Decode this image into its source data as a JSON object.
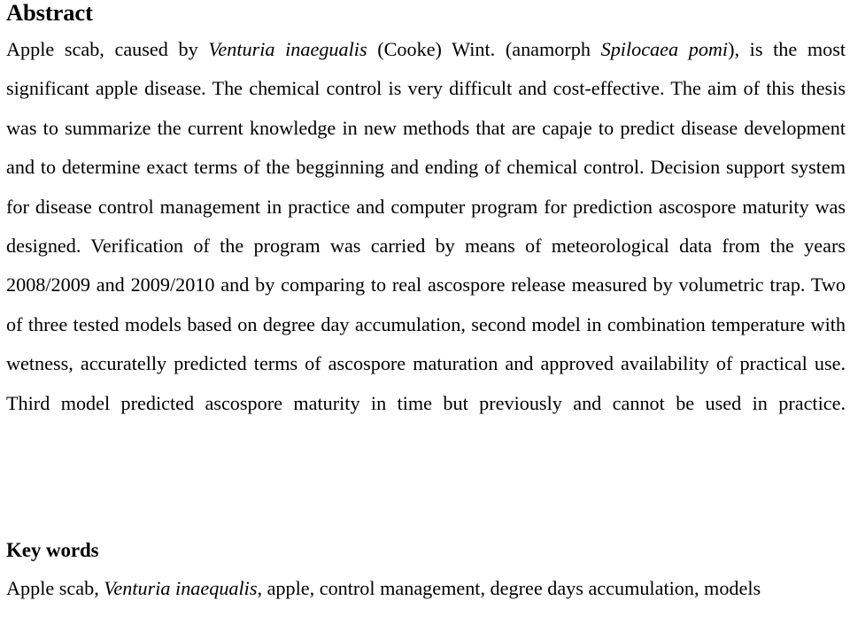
{
  "document": {
    "page_background": "#ffffff",
    "text_color": "#000000"
  },
  "abstract": {
    "heading": "Abstract",
    "paragraph_parts": [
      {
        "text": "Apple scab, caused by ",
        "style": "normal"
      },
      {
        "text": "Venturia inaegualis",
        "style": "italic"
      },
      {
        "text": " (Cooke) Wint. (anamorph ",
        "style": "normal"
      },
      {
        "text": "Spilocaea pomi",
        "style": "italic"
      },
      {
        "text": "), is the most significant apple disease. The chemical control is very difficult and cost-effective. The aim of this thesis was to summarize the current knowledge in new methods that are capaje to predict disease development and to determine exact terms of the begginning and ending of chemical control. Decision support system for disease control management in practice and computer program for prediction ascospore maturity was designed. Verification of the program was carried by means of meteorological data from the years 2008/2009 and 2009/2010 and by comparing to real ascospore release measured by volumetric trap. Two of three tested models based on degree day accumulation, second model in combination temperature with wetness, accuratelly predicted terms of ascospore maturation and approved availability of practical use. Third model predicted ascospore maturity in time but previously and cannot be used in practice.",
        "style": "normal"
      }
    ],
    "paragraph_plain": "Apple scab, caused by Venturia inaegualis (Cooke) Wint. (anamorph Spilocaea pomi), is the most significant apple disease. The chemical control is very difficult and cost-effective. The aim of this thesis was to summarize the current knowledge in new methods that are capaje to predict disease development and to determine exact terms of the begginning and ending of chemical control. Decision support system for disease control management in practice and computer program for prediction ascospore maturity was designed. Verification of the program was carried by means of meteorological data from the years 2008/2009 and 2009/2010 and by comparing to real ascospore release measured by volumetric trap. Two of three tested models based on degree day accumulation, second model in combination temperature with wetness, accuratelly predicted terms of ascospore maturation and approved availability of practical use. Third model predicted ascospore maturity in time but previously and cannot be used in practice."
  },
  "keywords": {
    "heading": "Key words",
    "parts": [
      {
        "text": "Apple scab, ",
        "style": "normal"
      },
      {
        "text": "Venturia inaequalis,",
        "style": "italic"
      },
      {
        "text": " apple, control management, degree days accumulation, models",
        "style": "normal"
      }
    ],
    "plain": "Apple scab, Venturia inaequalis, apple, control management, degree days accumulation, models"
  }
}
